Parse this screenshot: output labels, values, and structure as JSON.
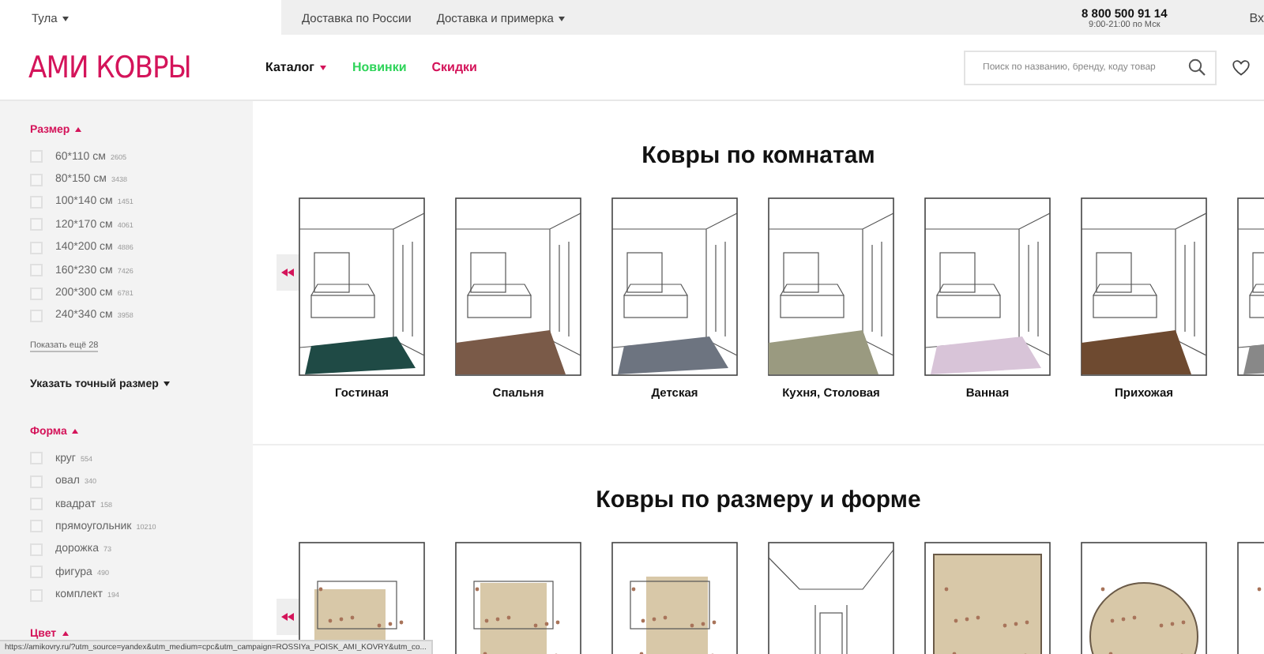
{
  "top_bar": {
    "city": "Тула",
    "links": [
      {
        "label": "Доставка по России",
        "dropdown": false
      },
      {
        "label": "Доставка и примерка",
        "dropdown": true
      }
    ],
    "phone": "8 800 500 91 14",
    "hours": "9:00-21:00 по Мск",
    "login": "Вх"
  },
  "header": {
    "logo": "АМИ КОВРЫ",
    "nav": [
      {
        "label": "Каталог",
        "kind": "catalog"
      },
      {
        "label": "Новинки",
        "kind": "new"
      },
      {
        "label": "Скидки",
        "kind": "sale"
      }
    ],
    "search": {
      "placeholder": "Поиск по названию, бренду, коду товар"
    }
  },
  "sidebar": {
    "filters": [
      {
        "kind": "group",
        "title": "Размер",
        "expanded": true,
        "options": [
          {
            "label": "60*110 см",
            "count": "2605",
            "checked": false
          },
          {
            "label": "80*150 см",
            "count": "3438",
            "checked": false
          },
          {
            "label": "100*140 см",
            "count": "1451",
            "checked": false
          },
          {
            "label": "120*170 см",
            "count": "4061",
            "checked": false
          },
          {
            "label": "140*200 см",
            "count": "4886",
            "checked": false
          },
          {
            "label": "160*230 см",
            "count": "7426",
            "checked": false
          },
          {
            "label": "200*300 см",
            "count": "6781",
            "checked": false
          },
          {
            "label": "240*340 см",
            "count": "3958",
            "checked": false
          }
        ],
        "show_more": "Показать ещё 28"
      },
      {
        "kind": "exact",
        "title": "Указать точный размер",
        "expanded": false
      },
      {
        "kind": "group",
        "title": "Форма",
        "expanded": true,
        "options": [
          {
            "label": "круг",
            "count": "554",
            "checked": false
          },
          {
            "label": "овал",
            "count": "340",
            "checked": false
          },
          {
            "label": "квадрат",
            "count": "158",
            "checked": false
          },
          {
            "label": "прямоугольник",
            "count": "10210",
            "checked": false
          },
          {
            "label": "дорожка",
            "count": "73",
            "checked": false
          },
          {
            "label": "фигура",
            "count": "490",
            "checked": false
          },
          {
            "label": "комплект",
            "count": "194",
            "checked": false
          }
        ]
      },
      {
        "kind": "group",
        "title": "Цвет",
        "expanded": true
      }
    ]
  },
  "sections": [
    {
      "title": "Ковры по комнатам",
      "items": [
        {
          "kind": "room",
          "label": "Гостиная"
        },
        {
          "kind": "room",
          "label": "Спальня"
        },
        {
          "kind": "room",
          "label": "Детская"
        },
        {
          "kind": "room",
          "label": "Кухня, Столовая"
        },
        {
          "kind": "room",
          "label": "Ванная"
        },
        {
          "kind": "room",
          "label": "Прихожая"
        },
        {
          "kind": "room"
        }
      ]
    },
    {
      "title": "Ковры по размеру и форме",
      "items": [
        {
          "kind": "plan"
        },
        {
          "kind": "plan"
        },
        {
          "kind": "plan"
        },
        {
          "kind": "plan"
        },
        {
          "kind": "plan"
        },
        {
          "kind": "plan"
        },
        {
          "kind": "plan"
        }
      ]
    }
  ],
  "status_bar": {
    "url": "https://amikovry.ru/?utm_source=yandex&utm_medium=cpc&utm_campaign=ROSSIYa_POISK_AMI_KOVRY&utm_co..."
  }
}
